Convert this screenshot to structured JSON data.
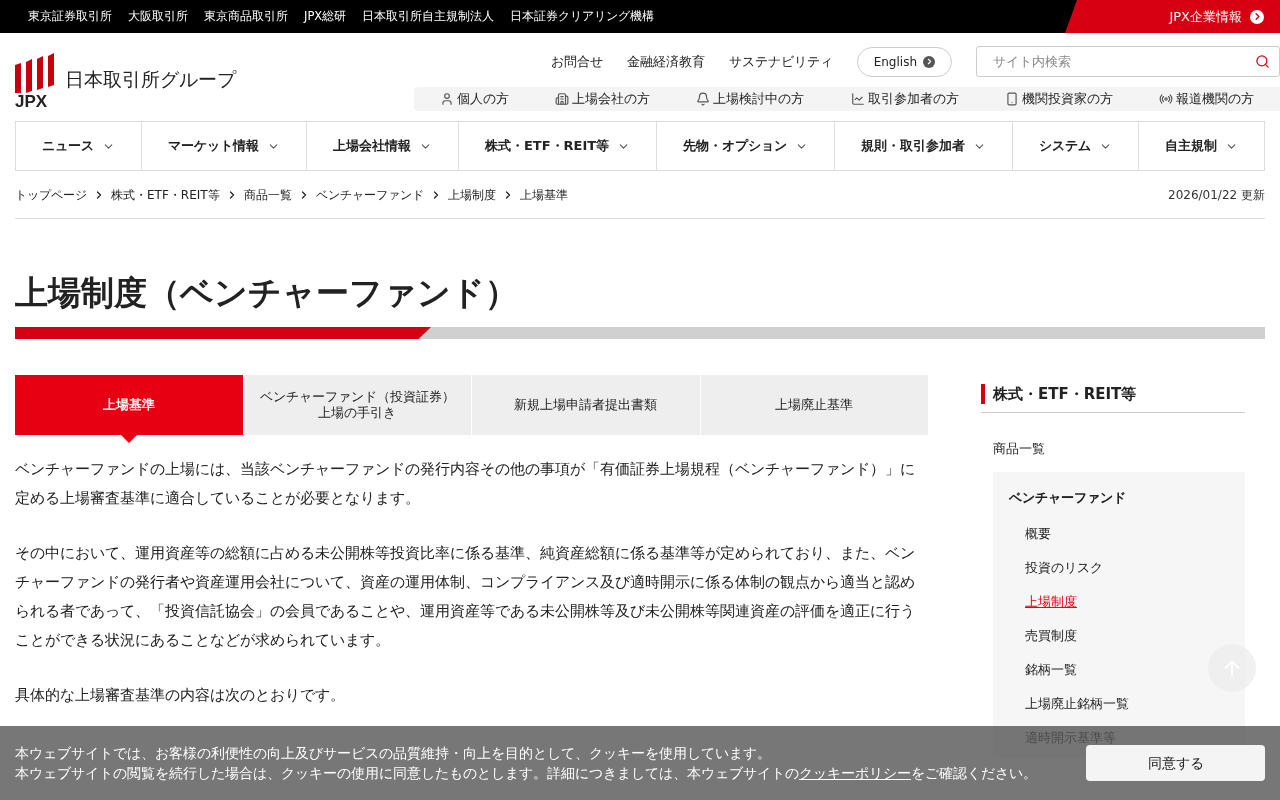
{
  "top_bar": {
    "links": [
      "東京証券取引所",
      "大阪取引所",
      "東京商品取引所",
      "JPX総研",
      "日本取引所自主規制法人",
      "日本証券クリアリング機構"
    ],
    "corporate_link": "JPX企業情報"
  },
  "header": {
    "logo_mark": "JPX",
    "logo_text": "日本取引所グループ",
    "utility_links": [
      "お問合せ",
      "金融経済教育",
      "サステナビリティ"
    ],
    "language_button": "English",
    "search": {
      "placeholder": "サイト内検索"
    },
    "audience_links": [
      {
        "kind": "person",
        "label": "個人の方"
      },
      {
        "kind": "building",
        "label": "上場会社の方"
      },
      {
        "kind": "bell",
        "label": "上場検討中の方"
      },
      {
        "kind": "chart",
        "label": "取引参加者の方"
      },
      {
        "kind": "phone",
        "label": "機関投資家の方"
      },
      {
        "kind": "broadcast",
        "label": "報道機関の方"
      }
    ]
  },
  "main_nav": [
    "ニュース",
    "マーケット情報",
    "上場会社情報",
    "株式・ETF・REIT等",
    "先物・オプション",
    "規則・取引参加者",
    "システム",
    "自主規制"
  ],
  "breadcrumb": [
    "トップページ",
    "株式・ETF・REIT等",
    "商品一覧",
    "ベンチャーファンド",
    "上場制度",
    "上場基準"
  ],
  "updated": "2026/01/22 更新",
  "page_title": "上場制度（ベンチャーファンド）",
  "tabs": [
    {
      "lines": [
        "上場基準"
      ],
      "selected": true
    },
    {
      "lines": [
        "ベンチャーファンド（投資証券）",
        "上場の手引き"
      ],
      "selected": false
    },
    {
      "lines": [
        "新規上場申請者提出書類"
      ],
      "selected": false
    },
    {
      "lines": [
        "上場廃止基準"
      ],
      "selected": false
    }
  ],
  "paragraphs": [
    "ベンチャーファンドの上場には、当該ベンチャーファンドの発行内容その他の事項が「有価証券上場規程（ベンチャーファンド）」に定める上場審査基準に適合していることが必要となります。",
    "その中において、運用資産等の総額に占める未公開株等投資比率に係る基準、純資産総額に係る基準等が定められており、また、ベンチャーファンドの発行者や資産運用会社について、資産の運用体制、コンプライアンス及び適時開示に係る体制の観点から適当と認められる者であって、「投資信託協会」の会員であることや、運用資産等である未公開株等及び未公開株等関連資産の評価を適正に行うことができる状況にあることなどが求められています。",
    "具体的な上場審査基準の内容は次のとおりです。"
  ],
  "sidebar": {
    "heading": "株式・ETF・REIT等",
    "section": "商品一覧",
    "group": "ベンチャーファンド",
    "items": [
      {
        "label": "概要",
        "selected": false
      },
      {
        "label": "投資のリスク",
        "selected": false
      },
      {
        "label": "上場制度",
        "selected": true
      },
      {
        "label": "売買制度",
        "selected": false
      },
      {
        "label": "銘柄一覧",
        "selected": false
      },
      {
        "label": "上場廃止銘柄一覧",
        "selected": false
      },
      {
        "label": "適時開示基準等",
        "selected": false
      }
    ]
  },
  "cookie_banner": {
    "first_line": "本ウェブサイトでは、お客様の利便性の向上及びサービスの品質維持・向上を目的として、クッキーを使用しています。",
    "text_before_link": "本ウェブサイトの閲覧を続行した場合は、クッキーの使用に同意したものとします。詳細につきましては、本ウェブサイトの",
    "link": "クッキーポリシー",
    "text_after_link": "をご確認ください。",
    "accept_button": "同意する"
  }
}
